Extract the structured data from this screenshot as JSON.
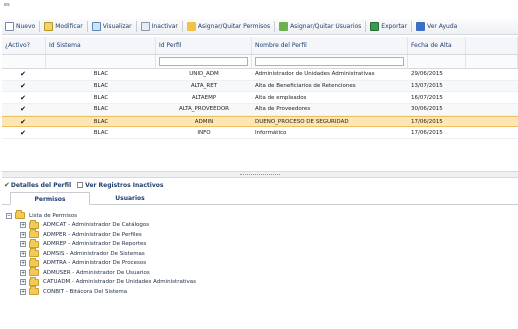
{
  "page_title": "es",
  "toolbar": {
    "nuevo": "Nuevo",
    "modificar": "Modificar",
    "visualizar": "Visualizar",
    "inactivar": "Inactivar",
    "asignar_permisos": "Asignar/Quitar Permisos",
    "asignar_usuarios": "Asignar/Quitar Usuarios",
    "exportar": "Exportar",
    "ver_ayuda": "Ver Ayuda"
  },
  "grid": {
    "headers": [
      "¿Activo?",
      "Id Sistema",
      "Id Perfil",
      "Nombre del Perfil",
      "Fecha de Alta"
    ],
    "rows": [
      {
        "activo": "✔",
        "sistema": "BLAC",
        "perfil": "UNID_ADM",
        "nombre": "Administrador de Unidades Administrativas",
        "fecha": "29/06/2015"
      },
      {
        "activo": "✔",
        "sistema": "BLAC",
        "perfil": "ALTA_RET",
        "nombre": "Alta de Beneficiarios de Retenciones",
        "fecha": "13/07/2015"
      },
      {
        "activo": "✔",
        "sistema": "BLAC",
        "perfil": "ALTAEMP",
        "nombre": "Alta de empleados",
        "fecha": "16/07/2015"
      },
      {
        "activo": "✔",
        "sistema": "BLAC",
        "perfil": "ALTA_PROVEEDOR",
        "nombre": "Alta de Proveedores",
        "fecha": "30/06/2015"
      },
      {
        "activo": "✔",
        "sistema": "BLAC",
        "perfil": "ADMIN",
        "nombre": "DUEÑO_PROCESO DE SEGURIDAD",
        "fecha": "17/06/2015"
      },
      {
        "activo": "✔",
        "sistema": "BLAC",
        "perfil": "INFO",
        "nombre": "Informático",
        "fecha": "17/06/2015"
      }
    ]
  },
  "detail": {
    "detalles_label": "Detalles del Perfil",
    "inactivos_label": "Ver Registros Inactivos"
  },
  "tabs": [
    "Permisos",
    "Usuarios"
  ],
  "tree": {
    "root": "Lista de Permisos",
    "items": [
      "ADMCAT - Administrador De Catálogos",
      "ADMPER - Administrador De Perfiles",
      "ADMREP - Administrador De Reportes",
      "ADMSIS - Administrador De Sistemas",
      "ADMTRA - Administrador De Procesos",
      "ADMUSER - Administrador De Usuarios",
      "CATUADM - Administrador De Unidades Administrativas",
      "CONBIT - Bitácora Del Sistema"
    ]
  },
  "colors": {
    "accent": "#1f3d6e",
    "selected_row": "#fde6b3",
    "folder": "#f2cb57"
  }
}
